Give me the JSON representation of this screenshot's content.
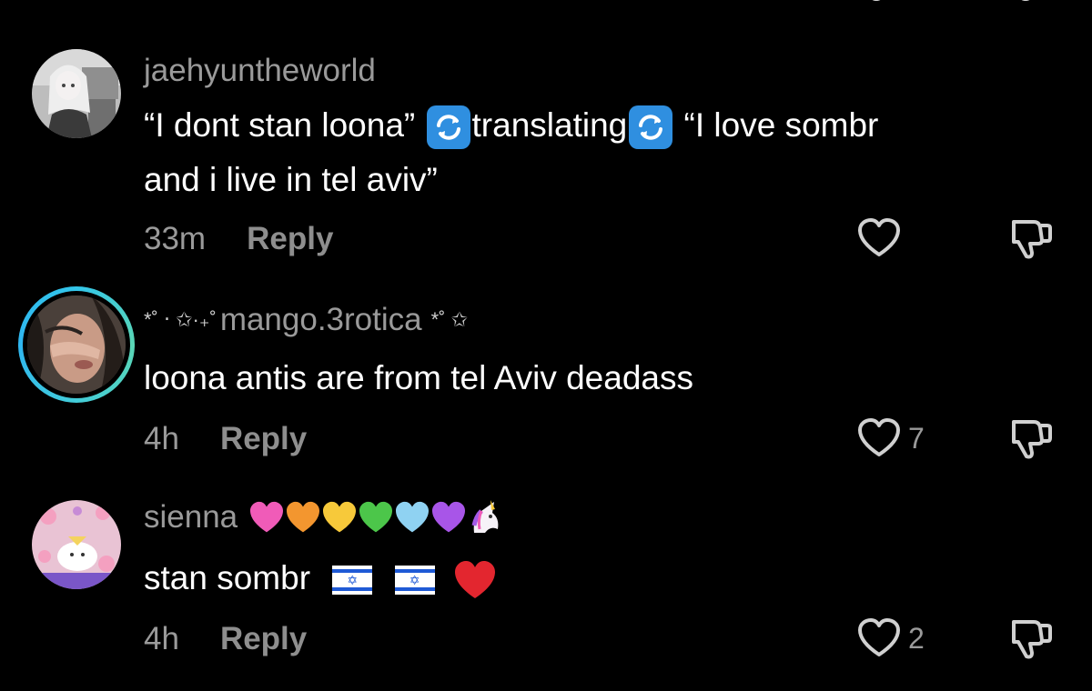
{
  "comments": [
    {
      "username": "jaehyuntheworld",
      "text_parts": [
        "“I dont stan loona” ",
        "translating",
        " “I love sombr",
        "and i live in tel aviv”"
      ],
      "time": "33m",
      "reply": "Reply",
      "likes": "",
      "icons": [
        "translate-arrows-icon"
      ]
    },
    {
      "username_prefix": "*˚ ‧ ✩·₊˚",
      "username": "mango.3rotica",
      "username_suffix": "*˚ ✩",
      "text": "loona antis are from tel Aviv deadass",
      "time": "4h",
      "reply": "Reply",
      "likes": "7"
    },
    {
      "username": "sienna",
      "username_emojis": [
        "pink-heart",
        "orange-heart",
        "yellow-heart",
        "green-heart",
        "light-blue-heart",
        "purple-heart",
        "unicorn"
      ],
      "text": "stan sombr",
      "text_emojis": [
        "israel-flag",
        "israel-flag",
        "red-heart"
      ],
      "time": "4h",
      "reply": "Reply",
      "likes": "2"
    }
  ],
  "colors": {
    "background": "#000000",
    "muted_text": "#9a9a9a",
    "text": "#ffffff",
    "story_ring": "#33c6ea"
  }
}
